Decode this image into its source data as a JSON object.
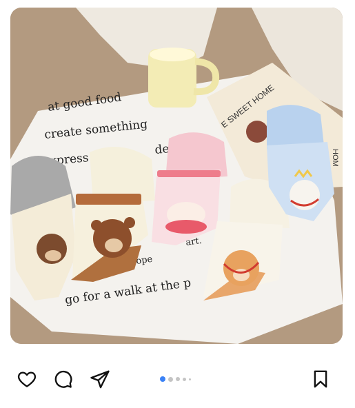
{
  "post": {
    "image_text": {
      "line1": "at good food",
      "line2": "create something",
      "line3": "xpress",
      "line4": "de f",
      "line5": "go for a walk at the p",
      "line6": "ope",
      "line7": "art.",
      "book_title": "E SWEET HOME",
      "book_side": "HOM"
    },
    "image_alt": "Flat lay of cartoon animal socks (bear, dog, cat, bunny) on a printed cloth with a yellow mug and a book"
  },
  "actions": {
    "like_icon": "heart-outline",
    "comment_icon": "speech-bubble-outline",
    "share_icon": "paper-plane-outline",
    "save_icon": "bookmark-outline"
  },
  "carousel": {
    "total_visible_dots": 5,
    "active_index": 0
  },
  "colors": {
    "accent": "#3b82f6",
    "dot_inactive": "#c4c4c4",
    "icon": "#111111"
  }
}
